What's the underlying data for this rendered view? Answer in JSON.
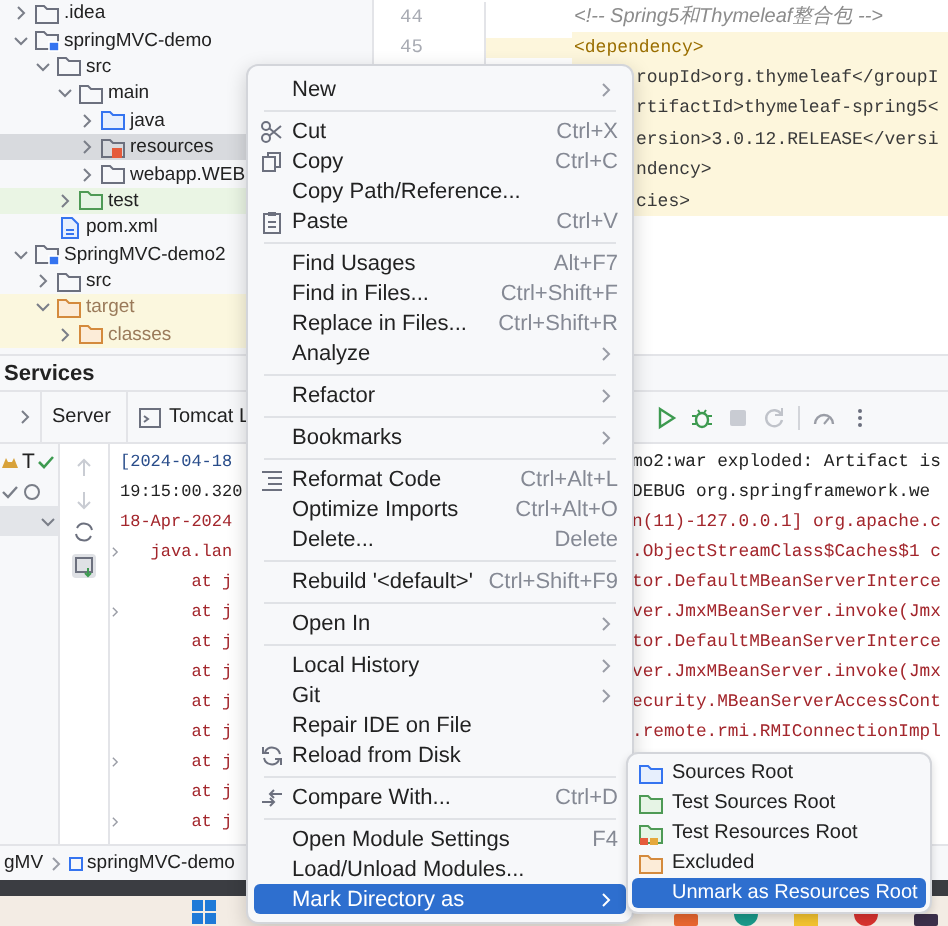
{
  "project_tree": [
    {
      "label": ".idea",
      "kind": "folder",
      "expanded": false,
      "selected": false
    },
    {
      "label": "springMVC-demo",
      "kind": "module",
      "expanded": true,
      "selected": false,
      "children": [
        {
          "label": "src",
          "kind": "folder",
          "expanded": true,
          "selected": false,
          "children": [
            {
              "label": "main",
              "kind": "folder",
              "expanded": true,
              "selected": false,
              "children": [
                {
                  "label": "java",
                  "kind": "source",
                  "expanded": false,
                  "selected": false
                },
                {
                  "label": "resources",
                  "kind": "resources",
                  "expanded": false,
                  "selected": true
                },
                {
                  "label": "webapp.WEB",
                  "kind": "folder",
                  "expanded": false,
                  "selected": false
                }
              ]
            },
            {
              "label": "test",
              "kind": "test",
              "expanded": false,
              "selected": false
            }
          ]
        },
        {
          "label": "pom.xml",
          "kind": "maven",
          "selected": false
        }
      ]
    },
    {
      "label": "SpringMVC-demo2",
      "kind": "module",
      "expanded": true,
      "selected": false,
      "children": [
        {
          "label": "src",
          "kind": "folder",
          "expanded": false,
          "selected": false
        },
        {
          "label": "target",
          "kind": "excluded",
          "expanded": true,
          "selected": false,
          "children": [
            {
              "label": "classes",
              "kind": "excluded",
              "expanded": false,
              "selected": false
            }
          ]
        }
      ]
    }
  ],
  "editor": {
    "lines": [
      {
        "number": "44",
        "text": "<!-- Spring5和Thymeleaf整合包 -->",
        "kind": "comment",
        "highlighted": false
      },
      {
        "number": "45",
        "text": "<dependency>",
        "kind": "tag",
        "highlighted": true
      },
      {
        "text": "roupId>org.thymeleaf</groupI",
        "kind": "covered",
        "highlighted": true
      },
      {
        "text": "rtifactId>thymeleaf-spring5<",
        "kind": "covered",
        "highlighted": true
      },
      {
        "text": "ersion>3.0.12.RELEASE</versi",
        "kind": "covered",
        "highlighted": true
      },
      {
        "text": "ndency>",
        "kind": "covered",
        "highlighted": true
      },
      {
        "text": "cies>",
        "kind": "covered",
        "highlighted": true
      }
    ]
  },
  "services": {
    "title": "Services",
    "tabs": [
      {
        "label": "Server",
        "kind": "server"
      },
      {
        "label": "Tomcat L",
        "kind": "tomcat"
      }
    ],
    "server_label": "T",
    "console": [
      {
        "left": {
          "text": "[2024-04-18",
          "color": "#284c8a"
        },
        "right": {
          "text": "mo2:war exploded: Artifact is",
          "color": "#222222",
          "clipped": false
        },
        "foldable": false
      },
      {
        "left": {
          "text": "19:15:00.320",
          "color": "#222222"
        },
        "right": {
          "text": "DEBUG org.springframework.we",
          "color": "#222222",
          "clipped": false
        },
        "foldable": false
      },
      {
        "left": {
          "text": "18-Apr-2024",
          "color": "#a3262c"
        },
        "right": {
          "text": "n(11)-127.0.0.1] org.apache.c",
          "color": "#a3262c",
          "clipped": false
        },
        "foldable": false
      },
      {
        "left": {
          "text": "   java.lan",
          "color": "#a3262c"
        },
        "right": {
          "text": ".ObjectStreamClass$Caches$1 c",
          "color": "#a3262c",
          "clipped": false
        },
        "foldable": true
      },
      {
        "left": {
          "text": "       at j",
          "color": "#a3262c"
        },
        "right": {
          "text": "tor.DefaultMBeanServerInterce",
          "color": "#a3262c",
          "clipped": false
        },
        "foldable": false
      },
      {
        "left": {
          "text": "       at j",
          "color": "#a3262c"
        },
        "right": {
          "text": "ver.JmxMBeanServer.invoke(Jmx",
          "color": "#a3262c",
          "clipped": false
        },
        "foldable": true
      },
      {
        "left": {
          "text": "       at j",
          "color": "#a3262c"
        },
        "right": {
          "text": "tor.DefaultMBeanServerInterce",
          "color": "#a3262c",
          "clipped": false
        },
        "foldable": false
      },
      {
        "left": {
          "text": "       at j",
          "color": "#a3262c"
        },
        "right": {
          "text": "ver.JmxMBeanServer.invoke(Jmx",
          "color": "#a3262c",
          "clipped": false
        },
        "foldable": false
      },
      {
        "left": {
          "text": "       at j",
          "color": "#a3262c"
        },
        "right": {
          "text": "ecurity.MBeanServerAccessCont",
          "color": "#a3262c",
          "clipped": false
        },
        "foldable": false
      },
      {
        "left": {
          "text": "       at j",
          "color": "#a3262c"
        },
        "right": {
          "text": ".remote.rmi.RMIConnectionImpl",
          "color": "#a3262c",
          "clipped": false
        },
        "foldable": false
      },
      {
        "left": {
          "text": "       at j",
          "color": "#a3262c"
        },
        "foldable": true
      },
      {
        "left": {
          "text": "       at j",
          "color": "#a3262c"
        },
        "foldable": false
      },
      {
        "left": {
          "text": "       at j",
          "color": "#a3262c"
        },
        "foldable": true
      }
    ]
  },
  "breadcrumb": [
    {
      "label": "gMV",
      "kind": "text"
    },
    {
      "label": "springMVC-demo",
      "kind": "module"
    }
  ],
  "menu": {
    "groups": [
      [
        {
          "label": "New",
          "kind": "plain",
          "submenu": true,
          "selected": false
        }
      ],
      [
        {
          "label": "Cut",
          "kind": "cut",
          "shortcut": "Ctrl+X",
          "submenu": false,
          "selected": false
        },
        {
          "label": "Copy",
          "kind": "copy",
          "shortcut": "Ctrl+C",
          "submenu": false,
          "selected": false
        },
        {
          "label": "Copy Path/Reference...",
          "kind": "plain",
          "submenu": false,
          "selected": false
        },
        {
          "label": "Paste",
          "kind": "paste",
          "shortcut": "Ctrl+V",
          "submenu": false,
          "selected": false
        }
      ],
      [
        {
          "label": "Find Usages",
          "kind": "plain",
          "shortcut": "Alt+F7",
          "submenu": false,
          "selected": false
        },
        {
          "label": "Find in Files...",
          "kind": "plain",
          "shortcut": "Ctrl+Shift+F",
          "submenu": false,
          "selected": false
        },
        {
          "label": "Replace in Files...",
          "kind": "plain",
          "shortcut": "Ctrl+Shift+R",
          "submenu": false,
          "selected": false
        },
        {
          "label": "Analyze",
          "kind": "plain",
          "submenu": true,
          "selected": false
        }
      ],
      [
        {
          "label": "Refactor",
          "kind": "plain",
          "submenu": true,
          "selected": false
        }
      ],
      [
        {
          "label": "Bookmarks",
          "kind": "plain",
          "submenu": true,
          "selected": false
        }
      ],
      [
        {
          "label": "Reformat Code",
          "kind": "reformat",
          "shortcut": "Ctrl+Alt+L",
          "submenu": false,
          "selected": false
        },
        {
          "label": "Optimize Imports",
          "kind": "plain",
          "shortcut": "Ctrl+Alt+O",
          "submenu": false,
          "selected": false
        },
        {
          "label": "Delete...",
          "kind": "plain",
          "shortcut": "Delete",
          "submenu": false,
          "selected": false
        }
      ],
      [
        {
          "label": "Rebuild '<default>'",
          "kind": "plain",
          "shortcut": "Ctrl+Shift+F9",
          "submenu": false,
          "selected": false
        }
      ],
      [
        {
          "label": "Open In",
          "kind": "plain",
          "submenu": true,
          "selected": false
        }
      ],
      [
        {
          "label": "Local History",
          "kind": "plain",
          "submenu": true,
          "selected": false
        },
        {
          "label": "Git",
          "kind": "plain",
          "submenu": true,
          "selected": false
        },
        {
          "label": "Repair IDE on File",
          "kind": "plain",
          "submenu": false,
          "selected": false
        },
        {
          "label": "Reload from Disk",
          "kind": "reload",
          "submenu": false,
          "selected": false
        }
      ],
      [
        {
          "label": "Compare With...",
          "kind": "compare",
          "shortcut": "Ctrl+D",
          "submenu": false,
          "selected": false
        }
      ],
      [
        {
          "label": "Open Module Settings",
          "kind": "plain",
          "shortcut": "F4",
          "submenu": false,
          "selected": false
        },
        {
          "label": "Load/Unload Modules...",
          "kind": "plain",
          "submenu": false,
          "selected": false
        },
        {
          "label": "Mark Directory as",
          "kind": "plain",
          "submenu": true,
          "selected": true
        }
      ]
    ]
  },
  "submenu": {
    "items": [
      {
        "label": "Sources Root",
        "kind": "sources",
        "selected": false
      },
      {
        "label": "Test Sources Root",
        "kind": "test-sources",
        "selected": false
      },
      {
        "label": "Test Resources Root",
        "kind": "test-resources",
        "selected": false
      },
      {
        "label": "Excluded",
        "kind": "excluded",
        "selected": false
      },
      {
        "label": "Unmark as Resources Root",
        "kind": "plain",
        "selected": true
      }
    ]
  }
}
